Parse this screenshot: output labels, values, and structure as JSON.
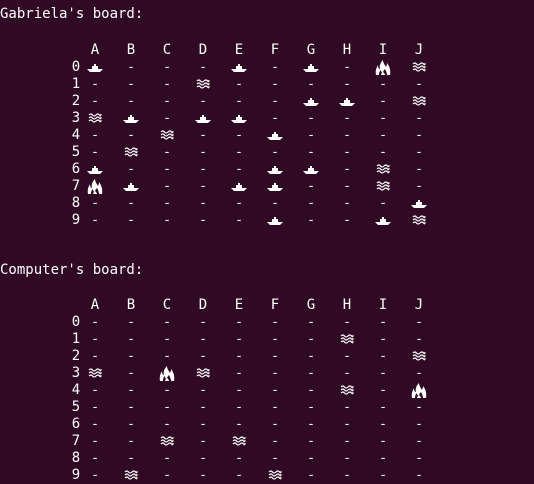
{
  "colors": {
    "background": "#300a24",
    "foreground": "#ffffff"
  },
  "boards": [
    {
      "title": "Gabriela's board:",
      "columns": [
        "A",
        "B",
        "C",
        "D",
        "E",
        "F",
        "G",
        "H",
        "I",
        "J"
      ],
      "rows": [
        "0",
        "1",
        "2",
        "3",
        "4",
        "5",
        "6",
        "7",
        "8",
        "9"
      ],
      "grid": [
        [
          "ship",
          "-",
          "-",
          "-",
          "ship",
          "-",
          "ship",
          "-",
          "fire",
          "water"
        ],
        [
          "-",
          "-",
          "-",
          "water",
          "-",
          "-",
          "-",
          "-",
          "-",
          "-"
        ],
        [
          "-",
          "-",
          "-",
          "-",
          "-",
          "-",
          "ship",
          "ship",
          "-",
          "water"
        ],
        [
          "water",
          "ship",
          "-",
          "ship",
          "ship",
          "-",
          "-",
          "-",
          "-",
          "-"
        ],
        [
          "-",
          "-",
          "water",
          "-",
          "-",
          "ship",
          "-",
          "-",
          "-",
          "-"
        ],
        [
          "-",
          "water",
          "-",
          "-",
          "-",
          "-",
          "-",
          "-",
          "-",
          "-"
        ],
        [
          "ship",
          "-",
          "-",
          "-",
          "-",
          "ship",
          "ship",
          "-",
          "water",
          "-"
        ],
        [
          "fire",
          "ship",
          "-",
          "-",
          "ship",
          "ship",
          "-",
          "-",
          "water",
          "-"
        ],
        [
          "-",
          "-",
          "-",
          "-",
          "-",
          "-",
          "-",
          "-",
          "-",
          "ship"
        ],
        [
          "-",
          "-",
          "-",
          "-",
          "-",
          "ship",
          "-",
          "-",
          "ship",
          "water"
        ]
      ]
    },
    {
      "title": "Computer's board:",
      "columns": [
        "A",
        "B",
        "C",
        "D",
        "E",
        "F",
        "G",
        "H",
        "I",
        "J"
      ],
      "rows": [
        "0",
        "1",
        "2",
        "3",
        "4",
        "5",
        "6",
        "7",
        "8",
        "9"
      ],
      "grid": [
        [
          "-",
          "-",
          "-",
          "-",
          "-",
          "-",
          "-",
          "-",
          "-",
          "-"
        ],
        [
          "-",
          "-",
          "-",
          "-",
          "-",
          "-",
          "-",
          "water",
          "-",
          "-"
        ],
        [
          "-",
          "-",
          "-",
          "-",
          "-",
          "-",
          "-",
          "-",
          "-",
          "water"
        ],
        [
          "water",
          "-",
          "fire",
          "water",
          "-",
          "-",
          "-",
          "-",
          "-",
          "-"
        ],
        [
          "-",
          "-",
          "-",
          "-",
          "-",
          "-",
          "-",
          "water",
          "-",
          "fire"
        ],
        [
          "-",
          "-",
          "-",
          "-",
          "-",
          "-",
          "-",
          "-",
          "-",
          "-"
        ],
        [
          "-",
          "-",
          "-",
          "-",
          "-",
          "-",
          "-",
          "-",
          "-",
          "-"
        ],
        [
          "-",
          "-",
          "water",
          "-",
          "water",
          "-",
          "-",
          "-",
          "-",
          "-"
        ],
        [
          "-",
          "-",
          "-",
          "-",
          "-",
          "-",
          "-",
          "-",
          "-",
          "-"
        ],
        [
          "-",
          "water",
          "-",
          "-",
          "-",
          "water",
          "-",
          "-",
          "-",
          "-"
        ]
      ]
    }
  ],
  "icons": {
    "-": "dash",
    "ship": "ship-icon",
    "water": "water-waves-icon",
    "fire": "fire-icon"
  }
}
